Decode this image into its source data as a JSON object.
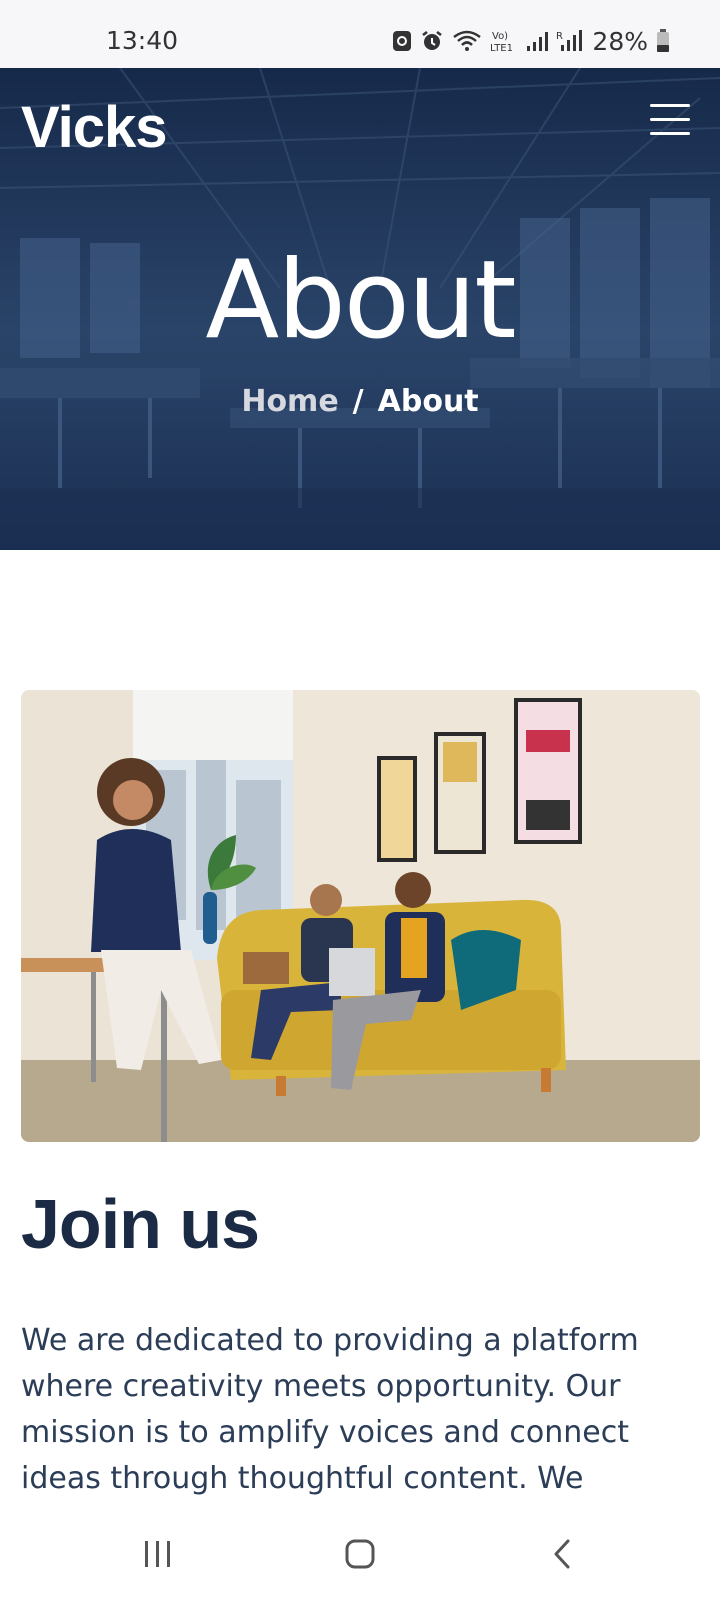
{
  "status_bar": {
    "time": "13:40",
    "battery": "28%",
    "icons": [
      "lock-icon",
      "alarm-icon",
      "wifi-icon",
      "volte-icon",
      "signal-icon",
      "signal-roaming-icon",
      "battery-icon"
    ]
  },
  "header": {
    "brand": "Vicks",
    "menu_icon": "hamburger-menu-icon"
  },
  "hero": {
    "title": "About",
    "breadcrumb": {
      "home": "Home",
      "separator": "/",
      "current": "About"
    }
  },
  "main": {
    "image_alt": "Team members in an office lounge",
    "heading": "Join us",
    "paragraph": "We are dedicated to providing a platform where creativity meets opportunity. Our mission is to amplify voices and connect ideas through thoughtful content. We explore new"
  },
  "nav_bar": {
    "buttons": [
      "recent-apps-icon",
      "home-icon",
      "back-icon"
    ]
  },
  "colors": {
    "hero_overlay": "#1d3356",
    "heading": "#1b2b45",
    "body_text": "#2b3d57"
  }
}
